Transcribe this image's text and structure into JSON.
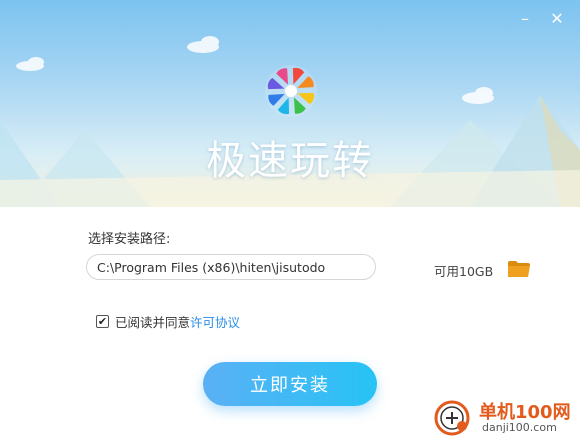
{
  "window": {
    "title": "极速玩转",
    "minimize_label": "–",
    "close_label": "✕"
  },
  "install": {
    "path_label": "选择安装路径:",
    "path_value": "C:\\Program Files (x86)\\hiten\\jisutodo",
    "free_space": "可用10GB",
    "folder_icon": "folder-icon",
    "agreement_checked": true,
    "agreement_text": "已阅读并同意",
    "license_link": "许可协议",
    "install_button": "立即安装"
  },
  "watermark": {
    "name": "单机100网",
    "url": "danji100.com"
  },
  "colors": {
    "accent": "#27c3f5",
    "link": "#2a8ee6",
    "folder": "#f0a020",
    "watermark": "#e25a1c"
  }
}
